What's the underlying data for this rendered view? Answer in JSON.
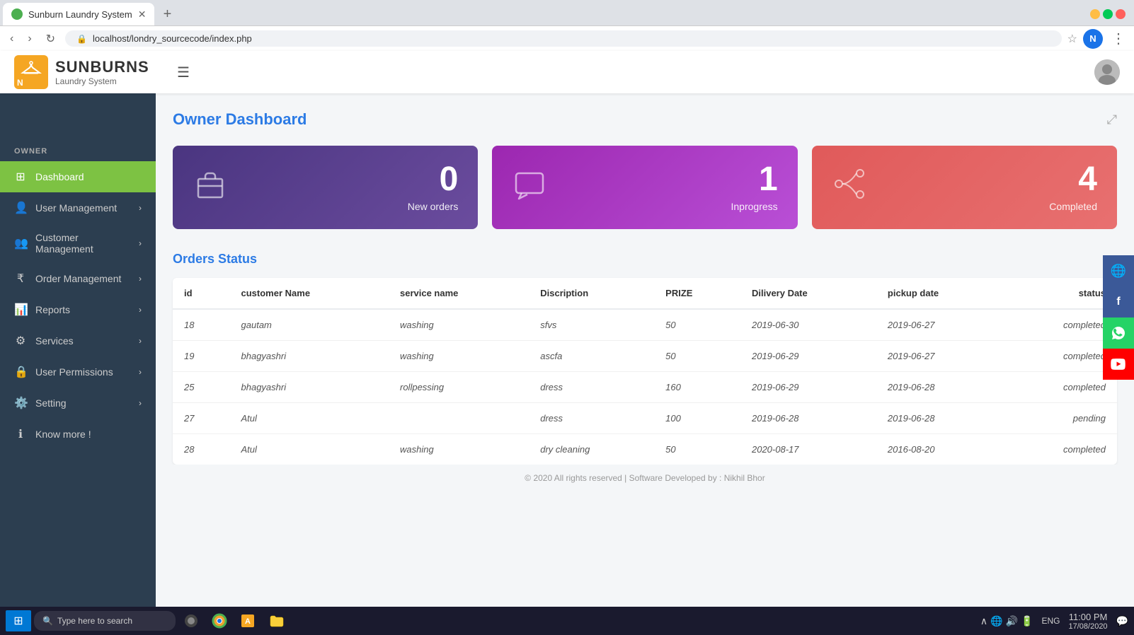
{
  "browser": {
    "tab_title": "Sunburn Laundry System",
    "url": "localhost/londry_sourcecode/index.php",
    "tab_new_label": "+",
    "profile_initial": "N"
  },
  "topbar": {
    "logo_initial": "N",
    "logo_brand": "SUNBURNS",
    "logo_subtitle": "Laundry System",
    "hamburger_icon": "☰"
  },
  "sidebar": {
    "section_label": "OWNER",
    "items": [
      {
        "id": "dashboard",
        "label": "Dashboard",
        "icon": "⊞",
        "active": true
      },
      {
        "id": "user-management",
        "label": "User Management",
        "icon": "👤",
        "active": false
      },
      {
        "id": "customer-management",
        "label": "Customer Management",
        "icon": "👥",
        "active": false
      },
      {
        "id": "order-management",
        "label": "Order Management",
        "icon": "₹",
        "active": false
      },
      {
        "id": "reports",
        "label": "Reports",
        "icon": "📊",
        "active": false
      },
      {
        "id": "services",
        "label": "Services",
        "icon": "⚙",
        "active": false
      },
      {
        "id": "user-permissions",
        "label": "User Permissions",
        "icon": "🔒",
        "active": false
      },
      {
        "id": "setting",
        "label": "Setting",
        "icon": "⚙️",
        "active": false
      },
      {
        "id": "know-more",
        "label": "Know more !",
        "icon": "ℹ",
        "active": false
      }
    ]
  },
  "dashboard": {
    "title": "Owner Dashboard",
    "expand_icon": "⤢",
    "stat_cards": [
      {
        "id": "new-orders",
        "value": "0",
        "label": "New orders",
        "icon": "💼",
        "color": "purple"
      },
      {
        "id": "inprogress",
        "value": "1",
        "label": "Inprogress",
        "icon": "💬",
        "color": "violet"
      },
      {
        "id": "completed",
        "value": "4",
        "label": "Completed",
        "icon": "⚡",
        "color": "red"
      }
    ],
    "orders_section_title": "Orders Status",
    "table": {
      "columns": [
        "id",
        "customer Name",
        "service name",
        "Discription",
        "PRIZE",
        "Dilivery Date",
        "pickup date",
        "status"
      ],
      "rows": [
        {
          "id": "18",
          "customer_name": "gautam",
          "service_name": "washing",
          "description": "sfvs",
          "prize": "50",
          "delivery_date": "2019-06-30",
          "pickup_date": "2019-06-27",
          "status": "completed"
        },
        {
          "id": "19",
          "customer_name": "bhagyashri",
          "service_name": "washing",
          "description": "ascfa",
          "prize": "50",
          "delivery_date": "2019-06-29",
          "pickup_date": "2019-06-27",
          "status": "completed"
        },
        {
          "id": "25",
          "customer_name": "bhagyashri",
          "service_name": "rollpessing",
          "description": "dress",
          "prize": "160",
          "delivery_date": "2019-06-29",
          "pickup_date": "2019-06-28",
          "status": "completed"
        },
        {
          "id": "27",
          "customer_name": "Atul",
          "service_name": "",
          "description": "dress",
          "prize": "100",
          "delivery_date": "2019-06-28",
          "pickup_date": "2019-06-28",
          "status": "pending"
        },
        {
          "id": "28",
          "customer_name": "Atul",
          "service_name": "washing",
          "description": "dry cleaning",
          "prize": "50",
          "delivery_date": "2020-08-17",
          "pickup_date": "2016-08-20",
          "status": "completed"
        }
      ]
    }
  },
  "social": {
    "buttons": [
      {
        "id": "globe",
        "icon": "🌐",
        "type": "globe"
      },
      {
        "id": "facebook",
        "icon": "f",
        "type": "fb"
      },
      {
        "id": "whatsapp",
        "icon": "✆",
        "type": "wa"
      },
      {
        "id": "youtube",
        "icon": "▶",
        "type": "yt"
      }
    ]
  },
  "footer": {
    "text": "© 2020 All rights reserved | Software Developed by : Nikhil Bhor"
  },
  "taskbar": {
    "search_placeholder": "Type here to search",
    "time": "11:00 PM",
    "date": "17/08/2020",
    "language": "ENG"
  }
}
